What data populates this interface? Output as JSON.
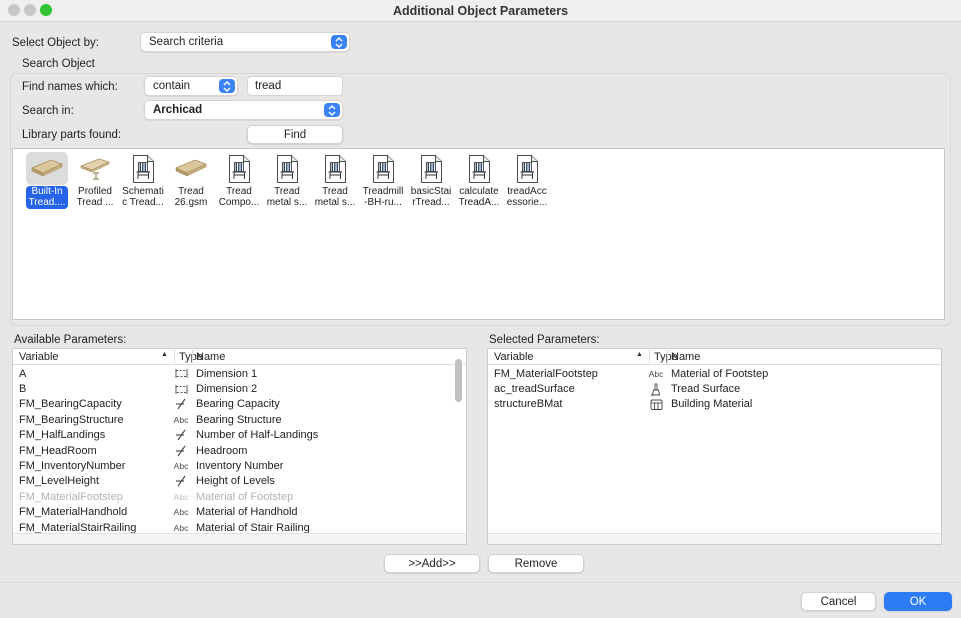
{
  "window": {
    "title": "Additional Object Parameters"
  },
  "form": {
    "select_object_by": {
      "label": "Select Object by:",
      "value": "Search criteria"
    },
    "group_label": "Search Object",
    "find_names": {
      "label": "Find names which:",
      "operator": "contain",
      "query": "tread"
    },
    "search_in": {
      "label": "Search in:",
      "value": "Archicad"
    },
    "library_parts": {
      "label": "Library parts found:",
      "find_button": "Find"
    }
  },
  "library_items": [
    {
      "label_line1": "Built-In",
      "label_line2": "Tread....",
      "icon": "tread-plank-icon",
      "selected": true
    },
    {
      "label_line1": "Profiled",
      "label_line2": "Tread ...",
      "icon": "tread-plank-profiled-icon",
      "selected": false
    },
    {
      "label_line1": "Schemati",
      "label_line2": "c Tread...",
      "icon": "gdl-doc-icon",
      "selected": false
    },
    {
      "label_line1": "Tread",
      "label_line2": "26.gsm",
      "icon": "tread-plank-icon",
      "selected": false
    },
    {
      "label_line1": "Tread",
      "label_line2": "Compo...",
      "icon": "gdl-doc-icon",
      "selected": false
    },
    {
      "label_line1": "Tread",
      "label_line2": "metal s...",
      "icon": "gdl-doc-icon",
      "selected": false
    },
    {
      "label_line1": "Tread",
      "label_line2": "metal s...",
      "icon": "gdl-doc-icon",
      "selected": false
    },
    {
      "label_line1": "Treadmill",
      "label_line2": "-BH-ru...",
      "icon": "gdl-doc-icon",
      "selected": false
    },
    {
      "label_line1": "basicStai",
      "label_line2": "rTread...",
      "icon": "gdl-doc-icon",
      "selected": false
    },
    {
      "label_line1": "calculate",
      "label_line2": "TreadA...",
      "icon": "gdl-doc-icon",
      "selected": false
    },
    {
      "label_line1": "treadAcc",
      "label_line2": "essorie...",
      "icon": "gdl-doc-icon",
      "selected": false
    }
  ],
  "table_headers": {
    "variable": "Variable",
    "type": "Type",
    "name": "Name",
    "sort_indicator": "▲"
  },
  "available": {
    "label": "Available Parameters:",
    "rows": [
      {
        "variable": "A",
        "type": "dimension-icon",
        "name": "Dimension 1",
        "disabled": false
      },
      {
        "variable": "B",
        "type": "dimension-icon",
        "name": "Dimension 2",
        "disabled": false
      },
      {
        "variable": "FM_BearingCapacity",
        "type": "number-icon",
        "name": "Bearing Capacity",
        "disabled": false
      },
      {
        "variable": "FM_BearingStructure",
        "type": "abc-icon",
        "name": "Bearing Structure",
        "disabled": false
      },
      {
        "variable": "FM_HalfLandings",
        "type": "number-icon",
        "name": "Number of Half-Landings",
        "disabled": false
      },
      {
        "variable": "FM_HeadRoom",
        "type": "number-icon",
        "name": "Headroom",
        "disabled": false
      },
      {
        "variable": "FM_InventoryNumber",
        "type": "abc-icon",
        "name": "Inventory Number",
        "disabled": false
      },
      {
        "variable": "FM_LevelHeight",
        "type": "number-icon",
        "name": "Height of Levels",
        "disabled": false
      },
      {
        "variable": "FM_MaterialFootstep",
        "type": "abc-icon",
        "name": "Material of Footstep",
        "disabled": true
      },
      {
        "variable": "FM_MaterialHandhold",
        "type": "abc-icon",
        "name": "Material of Handhold",
        "disabled": false
      },
      {
        "variable": "FM_MaterialStairRailing",
        "type": "abc-icon",
        "name": "Material of Stair Railing",
        "disabled": false
      }
    ]
  },
  "selected": {
    "label": "Selected Parameters:",
    "rows": [
      {
        "variable": "FM_MaterialFootstep",
        "type": "abc-icon",
        "name": "Material of Footstep",
        "disabled": false
      },
      {
        "variable": "ac_treadSurface",
        "type": "brush-icon",
        "name": "Tread Surface",
        "disabled": false
      },
      {
        "variable": "structureBMat",
        "type": "bmat-icon",
        "name": "Building Material",
        "disabled": false
      }
    ]
  },
  "actions": {
    "add": ">>Add>>",
    "remove": "Remove",
    "cancel": "Cancel",
    "ok": "OK"
  },
  "colors": {
    "accent_blue": "#2e7bf6",
    "selection_blue": "#2563e8",
    "traffic_green": "#33c433"
  }
}
